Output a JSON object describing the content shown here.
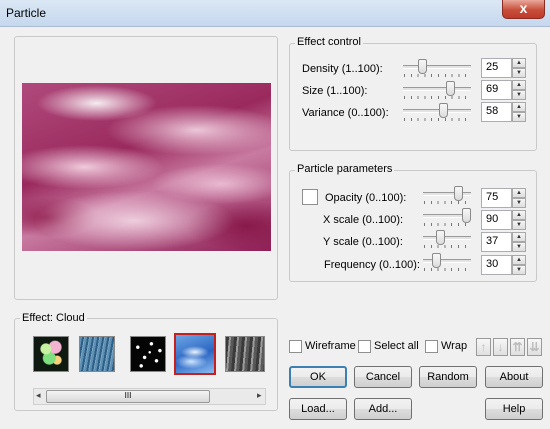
{
  "window": {
    "title": "Particle",
    "close_glyph": "x"
  },
  "effect": {
    "label": "Effect: Cloud"
  },
  "effect_thumbnails": [
    {
      "name": "bubbles",
      "selected": false
    },
    {
      "name": "rain",
      "selected": false
    },
    {
      "name": "snow",
      "selected": false
    },
    {
      "name": "cloud",
      "selected": true
    },
    {
      "name": "smoke",
      "selected": false
    }
  ],
  "scrollbar": {
    "left_glyph": "◂",
    "right_glyph": "▸",
    "grip_glyph": "III"
  },
  "effect_control": {
    "title": "Effect control",
    "rows": [
      {
        "label": "Density (1..100):",
        "value": "25"
      },
      {
        "label": "Size (1..100):",
        "value": "69"
      },
      {
        "label": "Variance (0..100):",
        "value": "58"
      }
    ]
  },
  "particle_parameters": {
    "title": "Particle parameters",
    "rows": [
      {
        "label": "Opacity (0..100):",
        "value": "75"
      },
      {
        "label": "X scale (0..100):",
        "value": "90"
      },
      {
        "label": "Y scale (0..100):",
        "value": "37"
      },
      {
        "label": "Frequency (0..100):",
        "value": "30"
      }
    ]
  },
  "options": {
    "wireframe": "Wireframe",
    "select_all": "Select all",
    "wrap": "Wrap"
  },
  "arrow_buttons": [
    "↑",
    "↓",
    "⇈",
    "⇊"
  ],
  "buttons": {
    "ok": "OK",
    "cancel": "Cancel",
    "random": "Random",
    "about": "About",
    "load": "Load...",
    "add": "Add...",
    "help": "Help"
  },
  "spin": {
    "up": "▲",
    "down": "▼"
  }
}
